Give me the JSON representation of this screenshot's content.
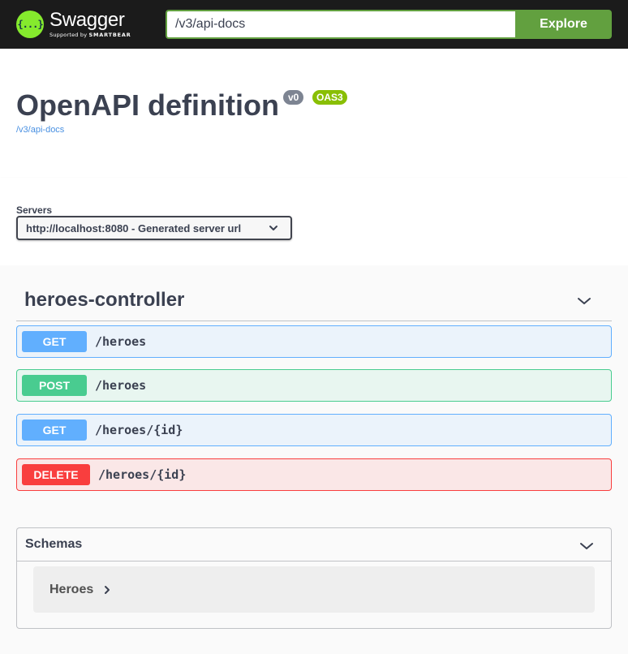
{
  "topbar": {
    "logo_mark": "{...}",
    "logo_name": "Swagger",
    "logo_sub_prefix": "Supported by",
    "logo_sub_brand": "SMARTBEAR",
    "url_value": "/v3/api-docs",
    "explore_label": "Explore"
  },
  "info": {
    "title": "OpenAPI definition",
    "version_badge": "v0",
    "oas_badge": "OAS3",
    "link": "/v3/api-docs"
  },
  "servers": {
    "label": "Servers",
    "selected": "http://localhost:8080 - Generated server url"
  },
  "tag": {
    "name": "heroes-controller"
  },
  "operations": [
    {
      "method": "GET",
      "path": "/heroes"
    },
    {
      "method": "POST",
      "path": "/heroes"
    },
    {
      "method": "GET",
      "path": "/heroes/{id}"
    },
    {
      "method": "DELETE",
      "path": "/heroes/{id}"
    }
  ],
  "schemas": {
    "title": "Schemas",
    "models": [
      "Heroes"
    ]
  },
  "colors": {
    "topbar": "#1b1b1b",
    "accent": "#62a03f",
    "get": "#61affe",
    "post": "#49cc90",
    "delete": "#f93e3e",
    "oas_badge": "#89bf04",
    "version_badge": "#7d8492"
  }
}
